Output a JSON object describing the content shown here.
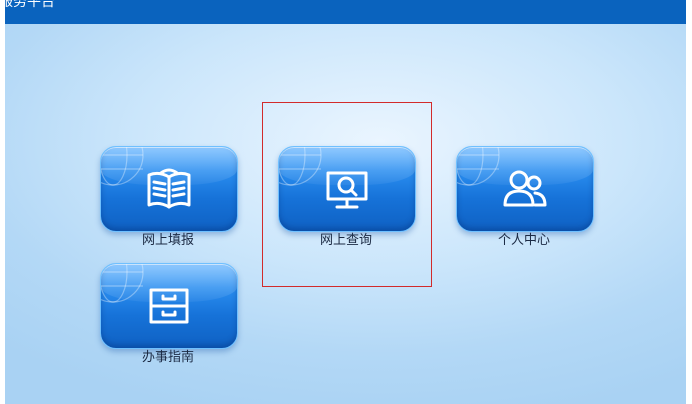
{
  "topbar": {
    "title": "服务平台"
  },
  "menu": {
    "items": [
      {
        "label": "网上填报",
        "icon": "book-icon"
      },
      {
        "label": "网上查询",
        "icon": "monitor-search-icon"
      },
      {
        "label": "个人中心",
        "icon": "users-icon"
      },
      {
        "label": "办事指南",
        "icon": "drawer-icon"
      }
    ]
  },
  "colors": {
    "topbar": "#0a63be",
    "tile": "#1672d8",
    "highlight": "#d22b2b"
  }
}
